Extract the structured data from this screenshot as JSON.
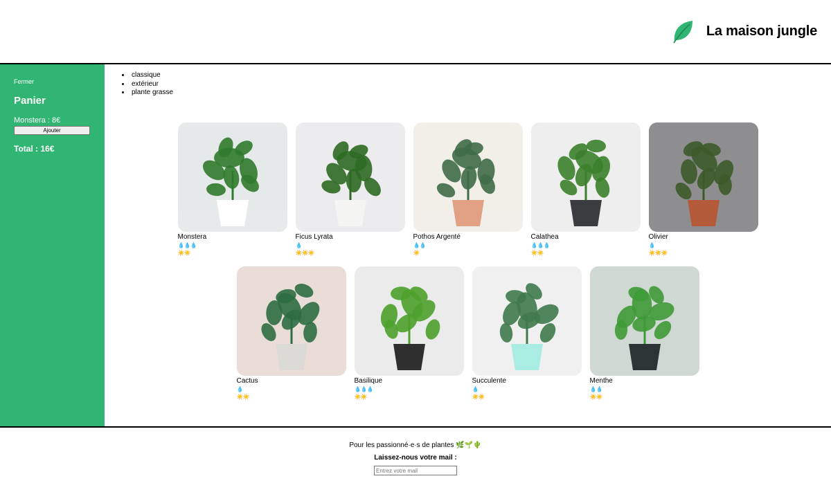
{
  "header": {
    "title": "La maison jungle",
    "logo_icon": "leaf-icon",
    "accent": "#31b572"
  },
  "cart": {
    "close_label": "Fermer",
    "title": "Panier",
    "items": [
      {
        "label": "Monstera : 8€"
      }
    ],
    "add_label": "Ajouter",
    "total": "Total : 16€",
    "background": "#31b572"
  },
  "categories": [
    "classique",
    "extérieur",
    "plante grasse"
  ],
  "plants": [
    {
      "name": "Monstera",
      "water": 3,
      "light": 2,
      "palette": [
        "#e6e9ea",
        "#2f7a2b",
        "#ffffff"
      ]
    },
    {
      "name": "Ficus Lyrata",
      "water": 1,
      "light": 3,
      "palette": [
        "#ececee",
        "#2d6a22",
        "#f4f4f2"
      ]
    },
    {
      "name": "Pothos Argenté",
      "water": 2,
      "light": 1,
      "palette": [
        "#f2efe9",
        "#3f6b48",
        "#e2a185"
      ]
    },
    {
      "name": "Calathea",
      "water": 3,
      "light": 2,
      "palette": [
        "#eeeeee",
        "#3b7f2b",
        "#3a3c40"
      ]
    },
    {
      "name": "Olivier",
      "water": 1,
      "light": 3,
      "palette": [
        "#8e8e90",
        "#3d5a2a",
        "#b25a3a"
      ]
    },
    {
      "name": "Cactus",
      "water": 1,
      "light": 2,
      "palette": [
        "#eadcd7",
        "#2e6d41",
        "#dcdad6"
      ]
    },
    {
      "name": "Basilique",
      "water": 3,
      "light": 2,
      "palette": [
        "#ebebeb",
        "#4ea12b",
        "#2f2f2f"
      ]
    },
    {
      "name": "Succulente",
      "water": 1,
      "light": 2,
      "palette": [
        "#f0f0f0",
        "#3f7a4d",
        "#a9ece2"
      ]
    },
    {
      "name": "Menthe",
      "water": 2,
      "light": 2,
      "palette": [
        "#cfd8d3",
        "#3f9a37",
        "#2d3436"
      ]
    }
  ],
  "scale_icons": {
    "water": "💧",
    "light": "☀️"
  },
  "footer": {
    "tagline": "Pour les passionné·e·s de plantes 🌿🌱🌵",
    "ask": "Laissez-nous votre mail :",
    "email_placeholder": "Entrez votre mail"
  }
}
